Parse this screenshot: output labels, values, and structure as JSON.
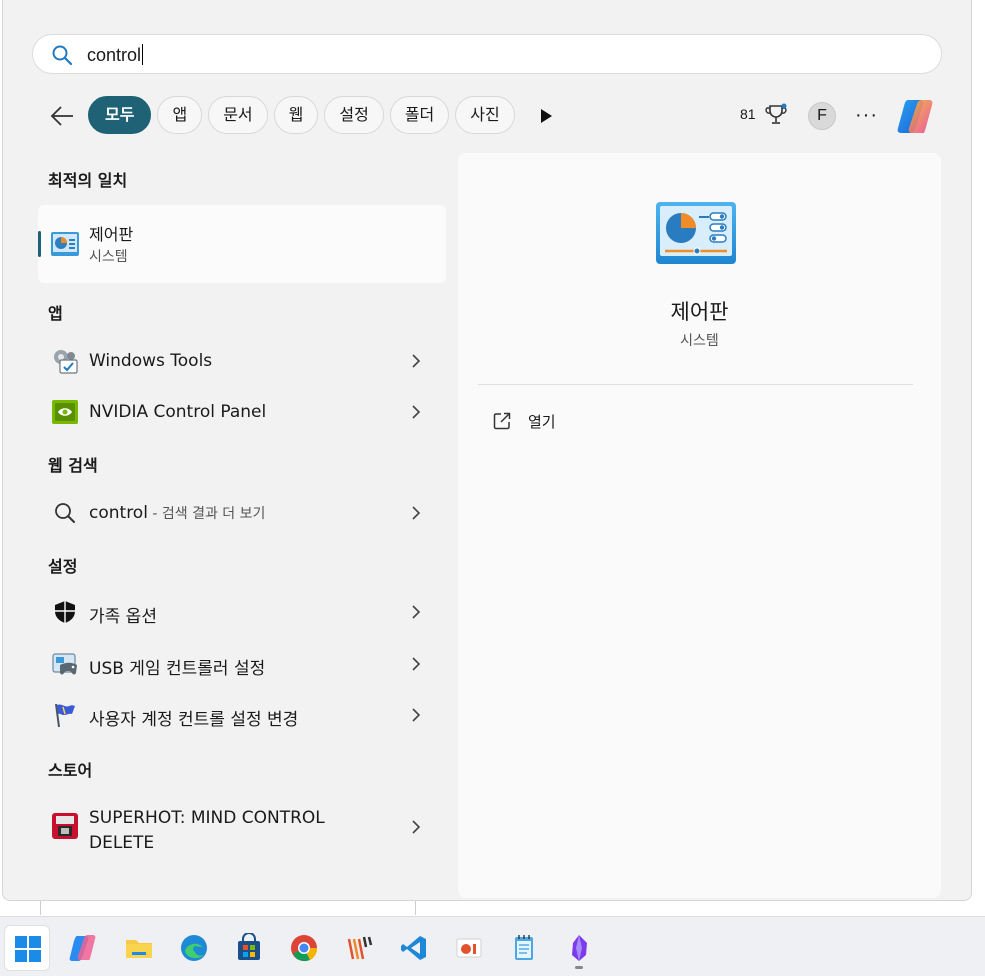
{
  "search": {
    "value": "control"
  },
  "filters": [
    "모두",
    "앱",
    "문서",
    "웹",
    "설정",
    "폴더",
    "사진"
  ],
  "header": {
    "points": "81",
    "avatar_letter": "F"
  },
  "best_match": {
    "section": "최적의 일치",
    "title": "제어판",
    "subtitle": "시스템"
  },
  "apps": {
    "section": "앱",
    "items": [
      {
        "label": "Windows Tools",
        "icon": "windows-tools-icon"
      },
      {
        "label": "NVIDIA Control Panel",
        "icon": "nvidia-icon"
      }
    ]
  },
  "web": {
    "section": "웹 검색",
    "query": "control",
    "suffix": " - 검색 결과 더 보기"
  },
  "settings": {
    "section": "설정",
    "items": [
      {
        "label": "가족 옵션",
        "icon": "shield-icon"
      },
      {
        "label": "USB 게임 컨트롤러 설정",
        "icon": "game-controller-icon"
      },
      {
        "label": "사용자 계정 컨트롤 설정 변경",
        "icon": "flag-icon"
      }
    ]
  },
  "store": {
    "section": "스토어",
    "items": [
      {
        "label_line1": "SUPERHOT: MIND CONTROL",
        "label_line2": "DELETE",
        "icon": "superhot-icon"
      }
    ]
  },
  "preview": {
    "title": "제어판",
    "subtitle": "시스템",
    "action_open": "열기"
  },
  "colors": {
    "accent": "#1f6276",
    "panel_bg": "#f2f2f2"
  },
  "taskbar": [
    "start-icon",
    "copilot-icon",
    "file-explorer-icon",
    "edge-icon",
    "store-icon",
    "chrome-icon",
    "app-icon",
    "vscode-icon",
    "presentation-icon",
    "notepad-icon",
    "obsidian-icon"
  ]
}
